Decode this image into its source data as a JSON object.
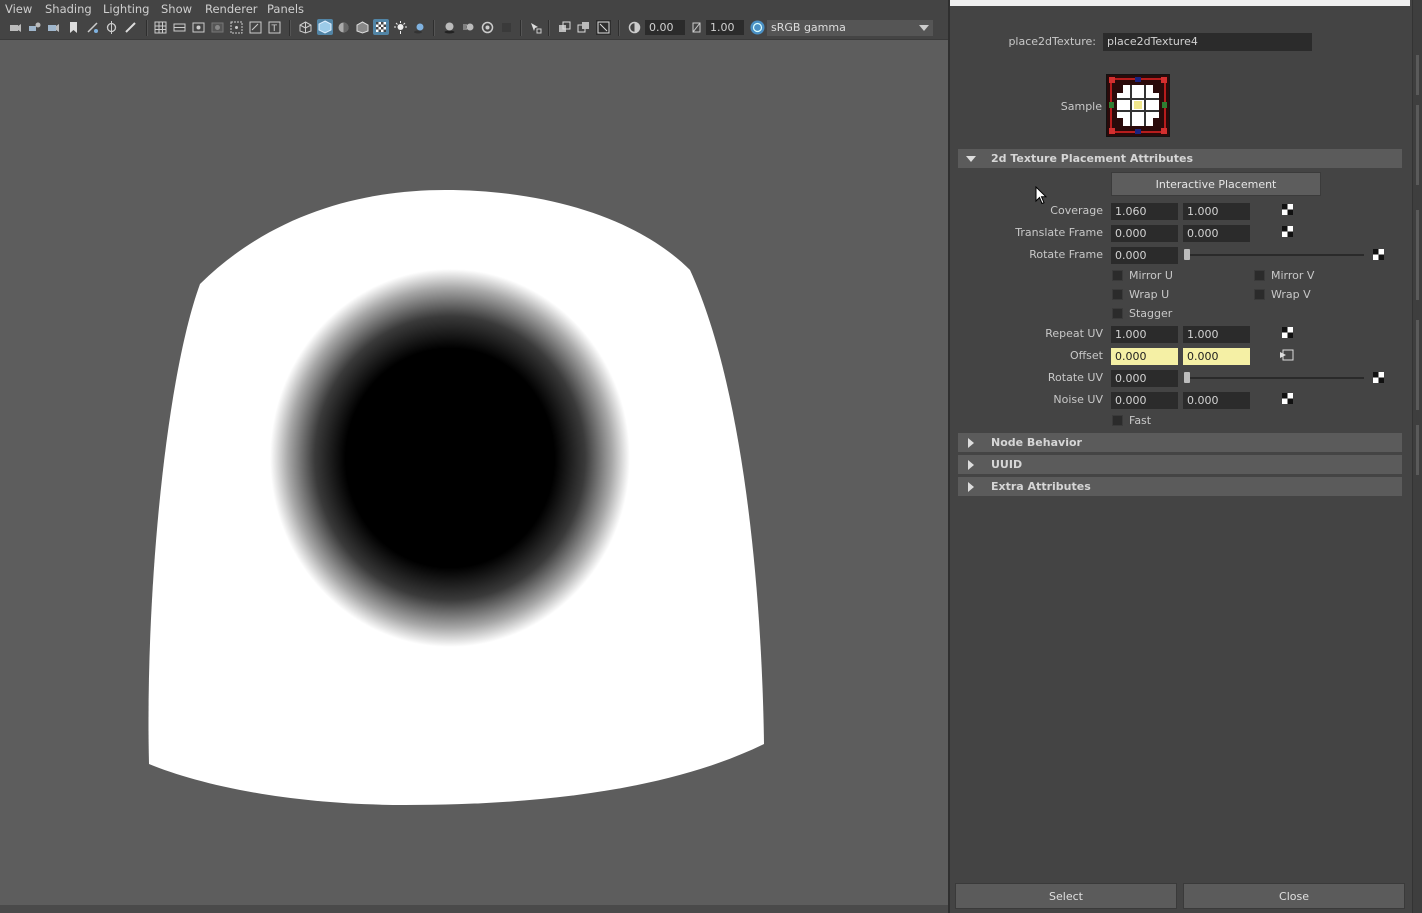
{
  "menubar": {
    "items": [
      "View",
      "Shading",
      "Lighting",
      "Show",
      "Renderer",
      "Panels"
    ]
  },
  "toolbar": {
    "exposure_value": "0.00",
    "gamma_value": "1.00",
    "colorspace_value": "sRGB gamma"
  },
  "attribute_editor": {
    "node_label": "place2dTexture:",
    "node_name": "place2dTexture4",
    "sample_label": "Sample",
    "sections": {
      "placement": "2d Texture Placement Attributes",
      "node_behavior": "Node Behavior",
      "uuid": "UUID",
      "extra": "Extra Attributes"
    },
    "interactive_placement_label": "Interactive Placement",
    "coverage": {
      "label": "Coverage",
      "u": "1.060",
      "v": "1.000"
    },
    "translate_frame": {
      "label": "Translate Frame",
      "u": "0.000",
      "v": "0.000"
    },
    "rotate_frame": {
      "label": "Rotate Frame",
      "value": "0.000"
    },
    "mirror_u": "Mirror U",
    "mirror_v": "Mirror V",
    "wrap_u": "Wrap U",
    "wrap_v": "Wrap V",
    "stagger": "Stagger",
    "repeat_uv": {
      "label": "Repeat UV",
      "u": "1.000",
      "v": "1.000"
    },
    "offset": {
      "label": "Offset",
      "u": "0.000",
      "v": "0.000"
    },
    "rotate_uv": {
      "label": "Rotate UV",
      "value": "0.000"
    },
    "noise_uv": {
      "label": "Noise UV",
      "u": "0.000",
      "v": "0.000"
    },
    "fast": "Fast",
    "select_label": "Select",
    "close_label": "Close"
  },
  "colors": {
    "highlight_field": "#f5f0a5",
    "panel_bg": "#444444",
    "viewport_bg": "#5d5d5d"
  }
}
